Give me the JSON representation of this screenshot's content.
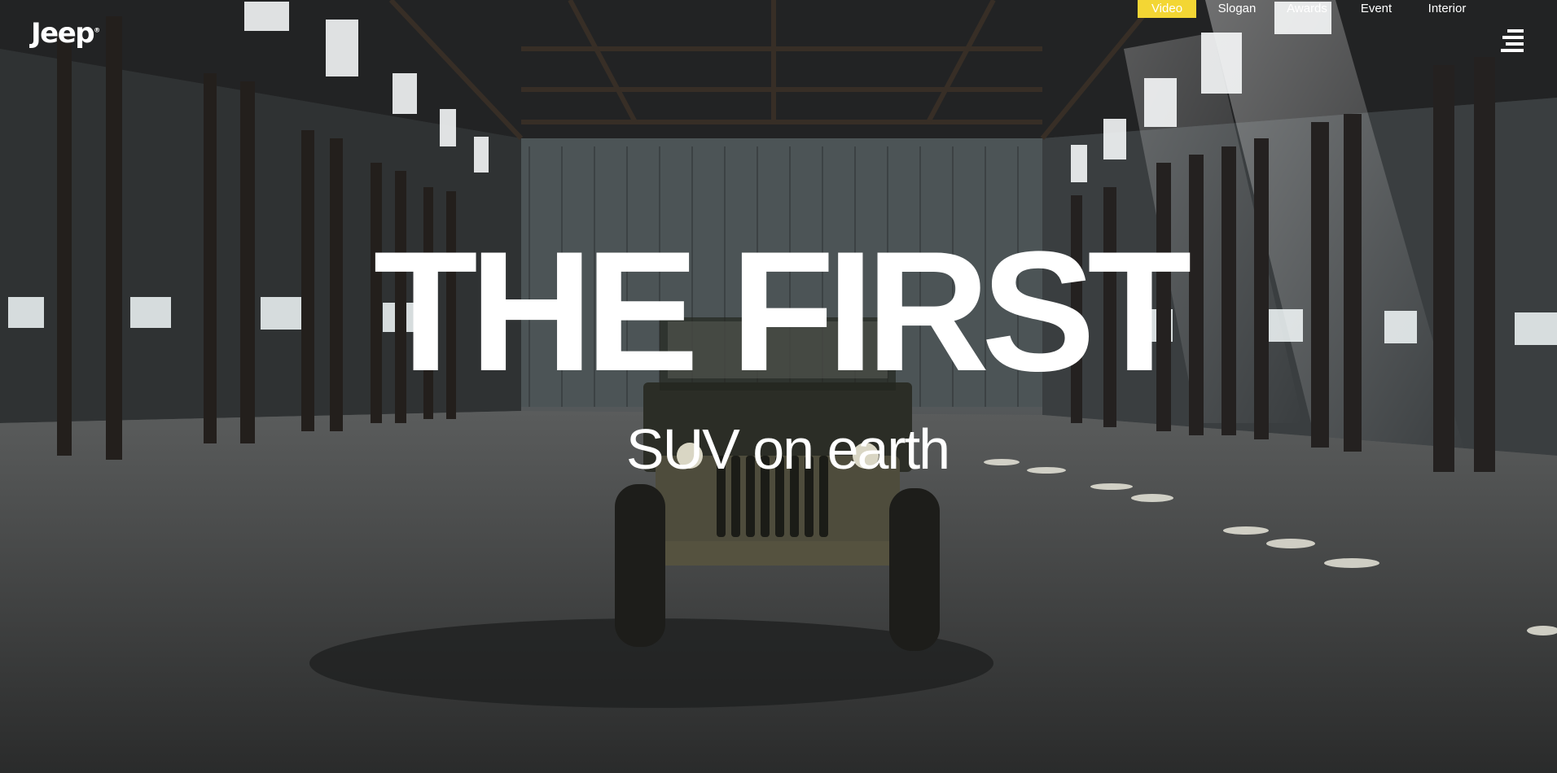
{
  "brand": {
    "logo_text": "Jeep",
    "logo_mark": "®"
  },
  "nav": {
    "items": [
      {
        "label": "Video",
        "active": true
      },
      {
        "label": "Slogan",
        "active": false
      },
      {
        "label": "Awards",
        "active": false
      },
      {
        "label": "Event",
        "active": false
      },
      {
        "label": "Interior",
        "active": false
      }
    ],
    "menu_icon": "hamburger-menu-icon",
    "active_color": "#f3d634"
  },
  "hero": {
    "title": "THE FIRST",
    "subtitle": "SUV on earth",
    "background": "warehouse-with-vintage-jeep"
  }
}
